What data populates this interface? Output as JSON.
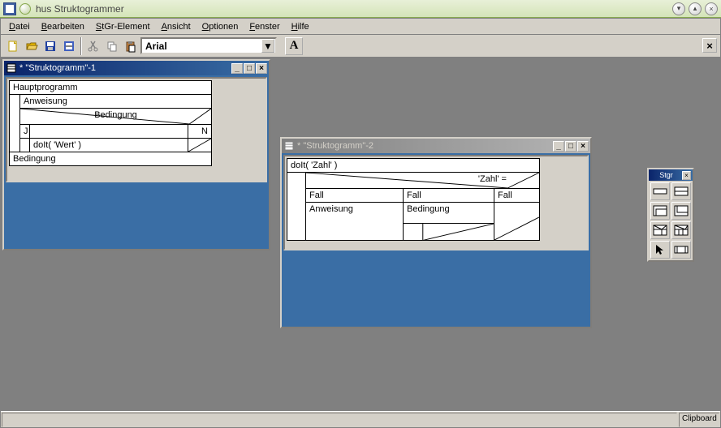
{
  "os": {
    "title": "hus Struktogrammer"
  },
  "menu": {
    "file": "Datei",
    "edit": "Bearbeiten",
    "element": "StGr-Element",
    "view": "Ansicht",
    "options": "Optionen",
    "window": "Fenster",
    "help": "Hilfe"
  },
  "toolbar": {
    "font": "Arial",
    "bold_label": "A"
  },
  "palette": {
    "title": "Stgr"
  },
  "win1": {
    "title": "* \"Struktogramm\"-1",
    "main": "Hauptprogramm",
    "anw": "Anweisung",
    "bed": "Bedingung",
    "j": "J",
    "n": "N",
    "call": "doIt( 'Wert' )",
    "bed2": "Bedingung"
  },
  "win2": {
    "title": "* \"Struktogramm\"-2",
    "call": "doIt( 'Zahl' )",
    "zahl": "'Zahl' =",
    "fall": "Fall",
    "anw": "Anweisung",
    "bed": "Bedingung"
  },
  "status": {
    "clipboard": "Clipboard"
  }
}
